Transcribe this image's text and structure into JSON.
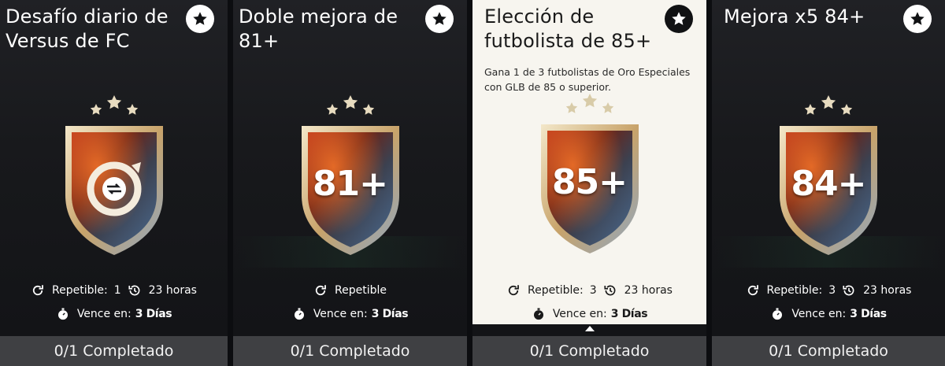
{
  "cards": [
    {
      "title": "Desafío diario de Versus de FC",
      "badge_text": "",
      "badge_icon": "rotate-swap-icon",
      "repeatable_label": "Repetible:",
      "repeatable_count": "1",
      "time_left": "23 horas",
      "expires_label": "Vence en:",
      "expires_value": "3 Días",
      "progress": "0/1 Completado"
    },
    {
      "title": "Doble mejora de 81+",
      "badge_text": "81+",
      "repeatable_label": "Repetible",
      "repeatable_count": "",
      "time_left": "",
      "expires_label": "Vence en:",
      "expires_value": "3 Días",
      "progress": "0/1 Completado"
    },
    {
      "title": "Elección de futbolista de 85+",
      "description": "Gana 1 de 3 futbolistas de Oro Especiales con GLB de 85 o superior.",
      "badge_text": "85+",
      "repeatable_label": "Repetible:",
      "repeatable_count": "3",
      "time_left": "23 horas",
      "expires_label": "Vence en:",
      "expires_value": "3 Días",
      "progress": "0/1 Completado",
      "selected": true
    },
    {
      "title": "Mejora x5 84+",
      "badge_text": "84+",
      "repeatable_label": "Repetible:",
      "repeatable_count": "3",
      "time_left": "23 horas",
      "expires_label": "Vence en:",
      "expires_value": "3 Días",
      "progress": "0/1 Completado"
    }
  ],
  "colors": {
    "footer_bg": "#3f4043",
    "selected_bg": "#f7f5ef",
    "star_gold": "#e8dcc0"
  },
  "icons": {
    "favorite": "star-icon",
    "repeat": "refresh-icon",
    "timer": "history-clock-icon",
    "expires": "stopwatch-icon"
  }
}
